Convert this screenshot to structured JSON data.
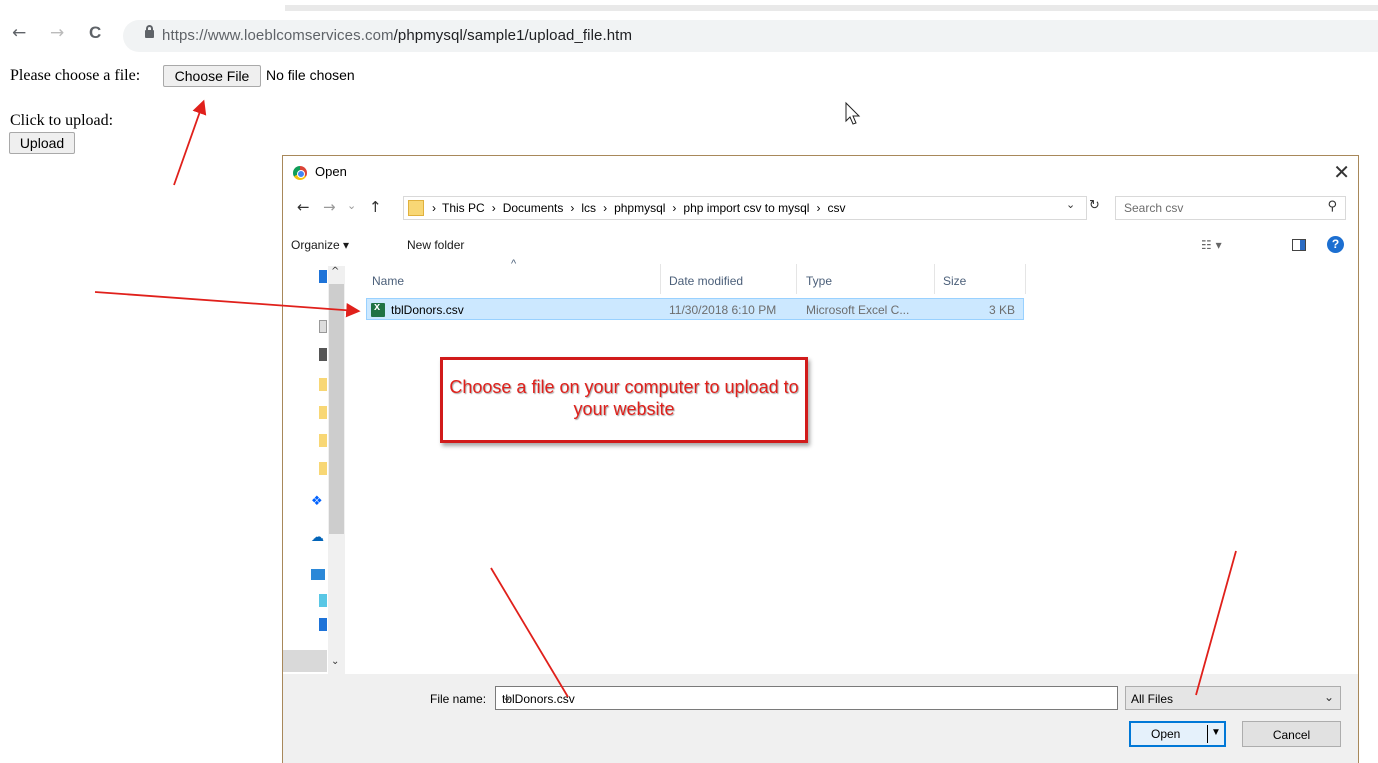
{
  "browser": {
    "back_glyph": "←",
    "forward_glyph": "→",
    "reload_glyph": "C",
    "url_host": "https://www.loeblcomservices.com",
    "url_path": "/phpmysql/sample1/upload_file.htm"
  },
  "page": {
    "choose_label": "Please choose a file:",
    "choose_button": "Choose File",
    "no_file": "No file chosen",
    "upload_label": "Click to upload:",
    "upload_button": "Upload"
  },
  "dialog": {
    "title": "Open",
    "close_glyph": "✕",
    "breadcrumbs": [
      "This PC",
      "Documents",
      "lcs",
      "phpmysql",
      "php import csv to mysql",
      "csv"
    ],
    "search_placeholder": "Search csv",
    "organize": "Organize ▾",
    "new_folder": "New folder",
    "help": "?",
    "columns": {
      "name": "Name",
      "date": "Date modified",
      "type": "Type",
      "size": "Size"
    },
    "files": [
      {
        "name": "tblDonors.csv",
        "date": "11/30/2018 6:10 PM",
        "type": "Microsoft Excel C...",
        "size": "3 KB"
      }
    ],
    "file_name_label": "File name:",
    "file_name_value": "tblDonors.csv",
    "filter_value": "All Files",
    "open_button": "Open",
    "cancel_button": "Cancel"
  },
  "annotation": {
    "callout_text": "Choose a file on your computer to upload to your website",
    "arrow_color": "#e0201b"
  }
}
